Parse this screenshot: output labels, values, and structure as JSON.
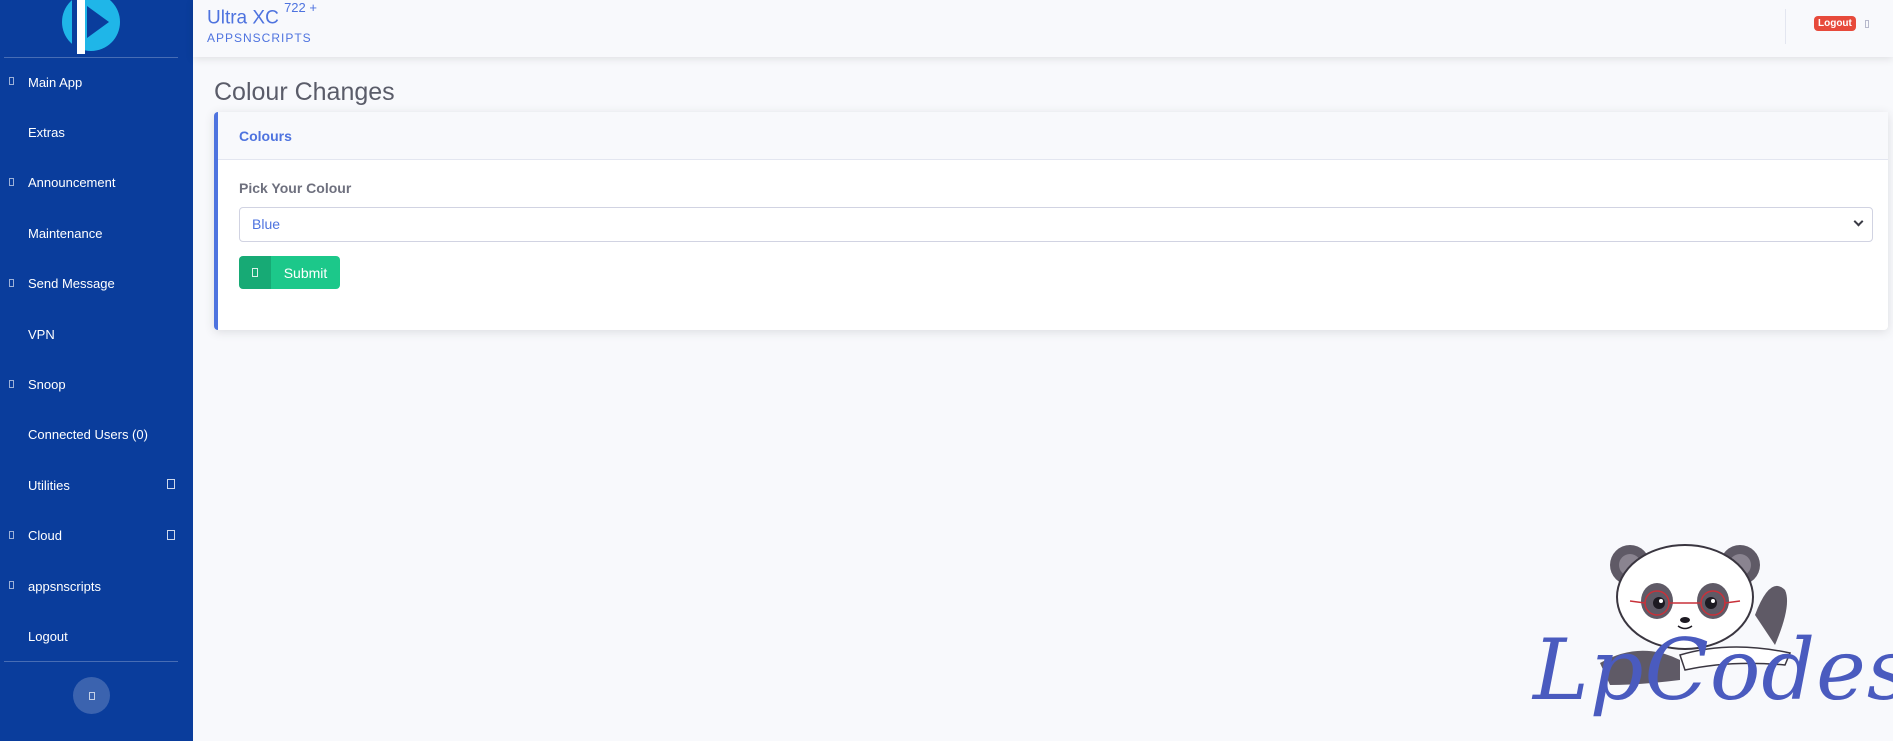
{
  "topbar": {
    "title": "Ultra XC",
    "version": "722 +",
    "subtitle": "APPSNSCRIPTS",
    "logout_badge": "Logout"
  },
  "sidebar": {
    "items": [
      {
        "label": "Main App",
        "has_bullet": true,
        "has_caret": false
      },
      {
        "label": "Extras",
        "has_bullet": false,
        "has_caret": false
      },
      {
        "label": "Announcement",
        "has_bullet": true,
        "has_caret": false
      },
      {
        "label": "Maintenance",
        "has_bullet": false,
        "has_caret": false
      },
      {
        "label": "Send Message",
        "has_bullet": true,
        "has_caret": false
      },
      {
        "label": "VPN",
        "has_bullet": false,
        "has_caret": false
      },
      {
        "label": "Snoop",
        "has_bullet": true,
        "has_caret": false
      },
      {
        "label": "Connected Users (0)",
        "has_bullet": false,
        "has_caret": false
      },
      {
        "label": "Utilities",
        "has_bullet": false,
        "has_caret": true
      },
      {
        "label": "Cloud",
        "has_bullet": true,
        "has_caret": true
      },
      {
        "label": "appsnscripts",
        "has_bullet": true,
        "has_caret": false
      },
      {
        "label": "Logout",
        "has_bullet": false,
        "has_caret": false
      }
    ]
  },
  "main": {
    "page_title": "Colour Changes",
    "card": {
      "header": "Colours",
      "field_label": "Pick Your Colour",
      "select_value": "Blue",
      "submit_label": "Submit"
    }
  },
  "watermark": {
    "text": "LpCodes"
  },
  "colors": {
    "sidebar_bg": "#0a3d9c",
    "accent": "#4e73df",
    "success": "#1cc88a",
    "danger": "#e74a3b"
  }
}
